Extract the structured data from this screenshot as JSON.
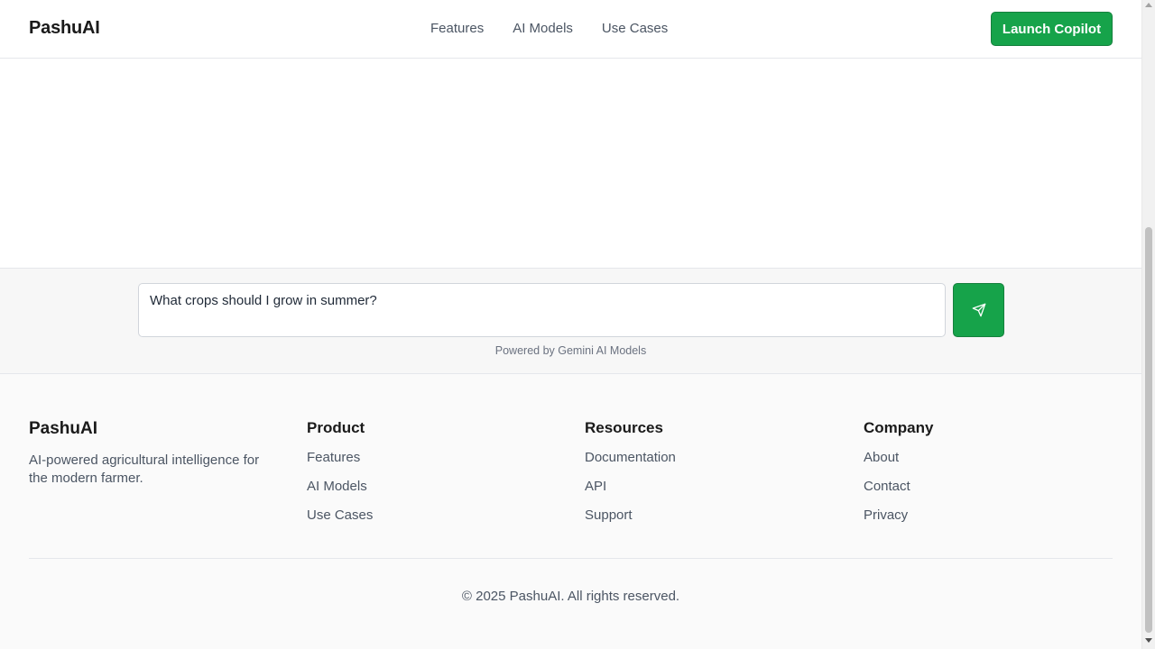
{
  "header": {
    "logo": "PashuAI",
    "nav": [
      "Features",
      "AI Models",
      "Use Cases"
    ],
    "launch_label": "Launch Copilot"
  },
  "chat": {
    "input_value": "What crops should I grow in summer?",
    "send_icon": "send-icon",
    "powered_by": "Powered by Gemini AI Models"
  },
  "footer": {
    "brand": "PashuAI",
    "description": "AI-powered agricultural intelligence for the modern farmer.",
    "columns": [
      {
        "heading": "Product",
        "links": [
          "Features",
          "AI Models",
          "Use Cases"
        ]
      },
      {
        "heading": "Resources",
        "links": [
          "Documentation",
          "API",
          "Support"
        ]
      },
      {
        "heading": "Company",
        "links": [
          "About",
          "Contact",
          "Privacy"
        ]
      }
    ],
    "copyright": "© 2025 PashuAI. All rights reserved."
  },
  "colors": {
    "accent": "#16a34a",
    "text": "#1f2937",
    "muted": "#4b5563"
  }
}
